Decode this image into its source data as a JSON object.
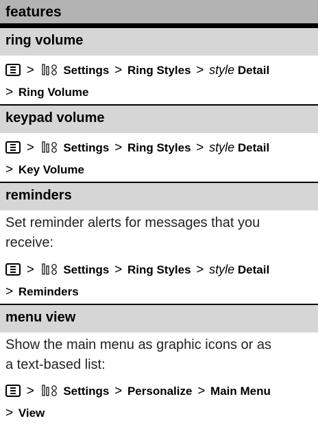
{
  "header": {
    "title": "features"
  },
  "sections": [
    {
      "title": "ring volume",
      "description": [],
      "path": {
        "items": [
          "Settings",
          "Ring Styles"
        ],
        "style_word": "style",
        "detail": "Detail",
        "last": "Ring Volume"
      }
    },
    {
      "title": "keypad volume",
      "description": [],
      "path": {
        "items": [
          "Settings",
          "Ring Styles"
        ],
        "style_word": "style",
        "detail": "Detail",
        "last": "Key Volume"
      }
    },
    {
      "title": "reminders",
      "description": [
        "Set reminder alerts for messages that you",
        "receive:"
      ],
      "path": {
        "items": [
          "Settings",
          "Ring Styles"
        ],
        "style_word": "style",
        "detail": "Detail",
        "last": "Reminders"
      }
    },
    {
      "title": "menu view",
      "description": [
        "Show the main menu as graphic icons or as",
        "a text-based list:"
      ],
      "path": {
        "items": [
          "Settings",
          "Personalize"
        ],
        "style_word": "",
        "detail": "Main Menu",
        "last": "View"
      }
    }
  ],
  "separator": ">",
  "icons": {
    "menu_key": "menu-key-icon",
    "settings": "settings-icon"
  }
}
